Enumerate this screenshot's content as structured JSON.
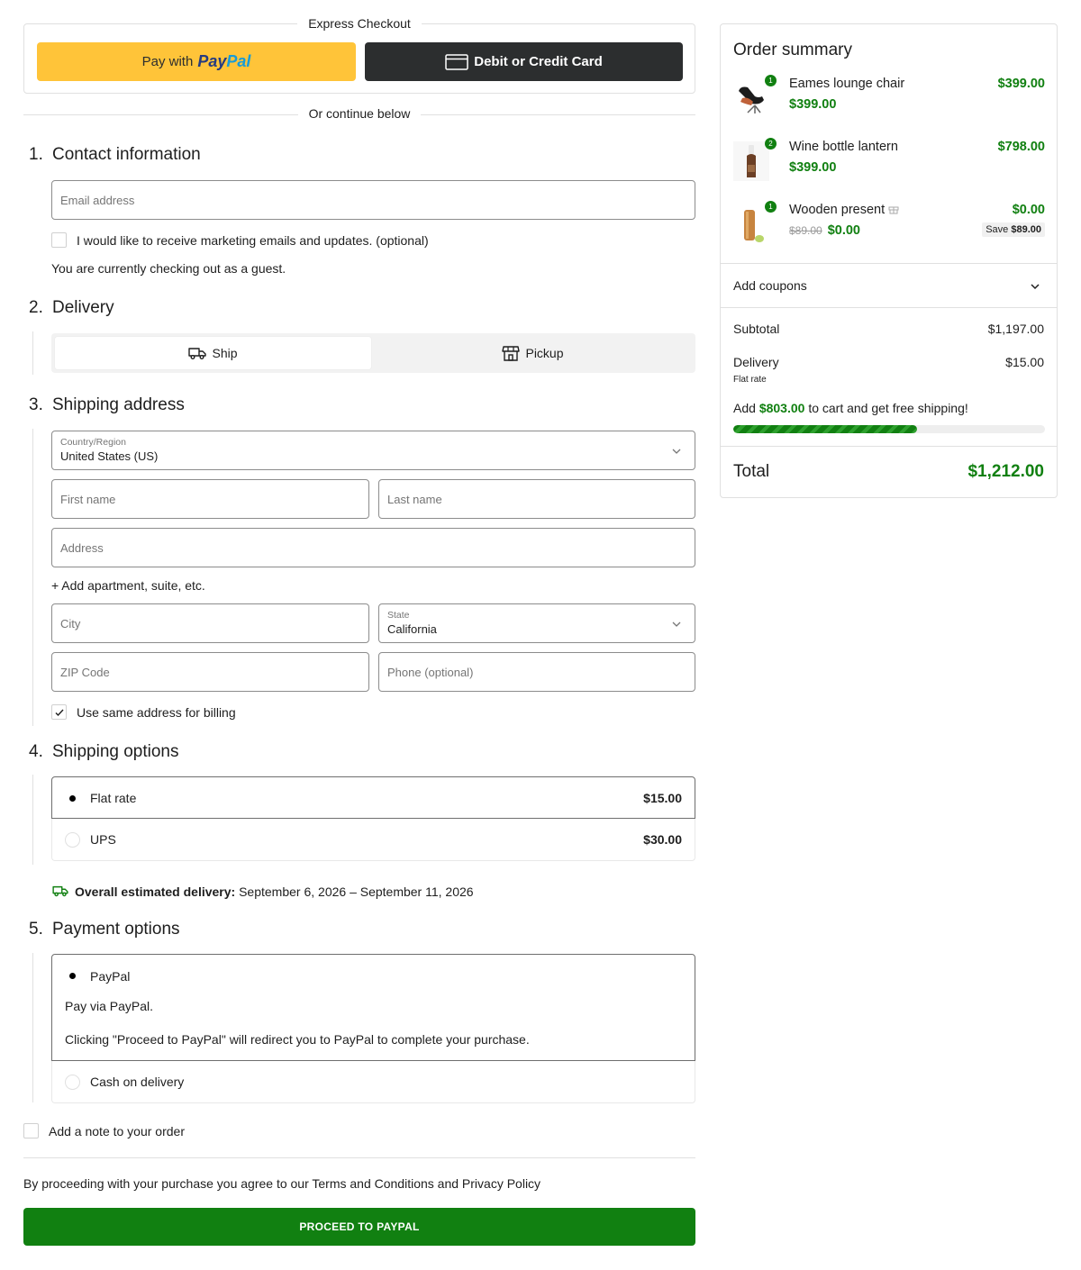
{
  "express": {
    "title": "Express Checkout",
    "paypal_prefix": "Pay with",
    "paypal_brand_1": "Pay",
    "paypal_brand_2": "Pal",
    "card_label": "Debit or Credit Card",
    "or_text": "Or continue below"
  },
  "contact": {
    "number": "1.",
    "title": "Contact information",
    "email_placeholder": "Email address",
    "marketing_label": "I would like to receive marketing emails and updates. (optional)",
    "guest_note": "You are currently checking out as a guest."
  },
  "delivery": {
    "number": "2.",
    "title": "Delivery",
    "ship_label": "Ship",
    "pickup_label": "Pickup"
  },
  "shipping_address": {
    "number": "3.",
    "title": "Shipping address",
    "country_label": "Country/Region",
    "country_value": "United States (US)",
    "first_name_placeholder": "First name",
    "last_name_placeholder": "Last name",
    "address_placeholder": "Address",
    "add_apartment": "+ Add apartment, suite, etc.",
    "city_placeholder": "City",
    "state_label": "State",
    "state_value": "California",
    "zip_placeholder": "ZIP Code",
    "phone_placeholder": "Phone (optional)",
    "billing_same_label": "Use same address for billing"
  },
  "shipping_options": {
    "number": "4.",
    "title": "Shipping options",
    "options": [
      {
        "label": "Flat rate",
        "price": "$15.00"
      },
      {
        "label": "UPS",
        "price": "$30.00"
      }
    ],
    "estimate_bold": "Overall estimated delivery:",
    "estimate_dates": "September 6, 2026 – September 11, 2026"
  },
  "payment": {
    "number": "5.",
    "title": "Payment options",
    "paypal_label": "PayPal",
    "paypal_desc": "Pay via PayPal.",
    "paypal_note": "Clicking \"Proceed to PayPal\" will redirect you to PayPal to complete your purchase.",
    "cod_label": "Cash on delivery"
  },
  "order_note_label": "Add a note to your order",
  "terms_text": "By proceeding with your purchase you agree to our Terms and Conditions and Privacy Policy",
  "proceed_label": "PROCEED TO PAYPAL",
  "summary": {
    "title": "Order summary",
    "items": [
      {
        "qty": "1",
        "name": "Eames lounge chair",
        "unit_price": "$399.00",
        "total": "$399.00",
        "icon": "chair-thumbnail"
      },
      {
        "qty": "2",
        "name": "Wine bottle lantern",
        "unit_price": "$399.00",
        "total": "$798.00",
        "icon": "bottle-thumbnail"
      },
      {
        "qty": "1",
        "name": "Wooden present",
        "old_price": "$89.00",
        "unit_price": "$0.00",
        "total": "$0.00",
        "save_label": "Save",
        "save_amount": "$89.00",
        "icon": "present-thumbnail"
      }
    ],
    "coupons_label": "Add coupons",
    "subtotal_label": "Subtotal",
    "subtotal_value": "$1,197.00",
    "delivery_label": "Delivery",
    "delivery_value": "$15.00",
    "delivery_method": "Flat rate",
    "free_ship_prefix": "Add",
    "free_ship_amount": "$803.00",
    "free_ship_suffix": "to cart and get free shipping!",
    "free_ship_progress": 0.59,
    "total_label": "Total",
    "total_value": "$1,212.00"
  },
  "colors": {
    "accent_green": "#118011",
    "paypal_yellow": "#ffc439",
    "card_dark": "#2c2e2f"
  }
}
